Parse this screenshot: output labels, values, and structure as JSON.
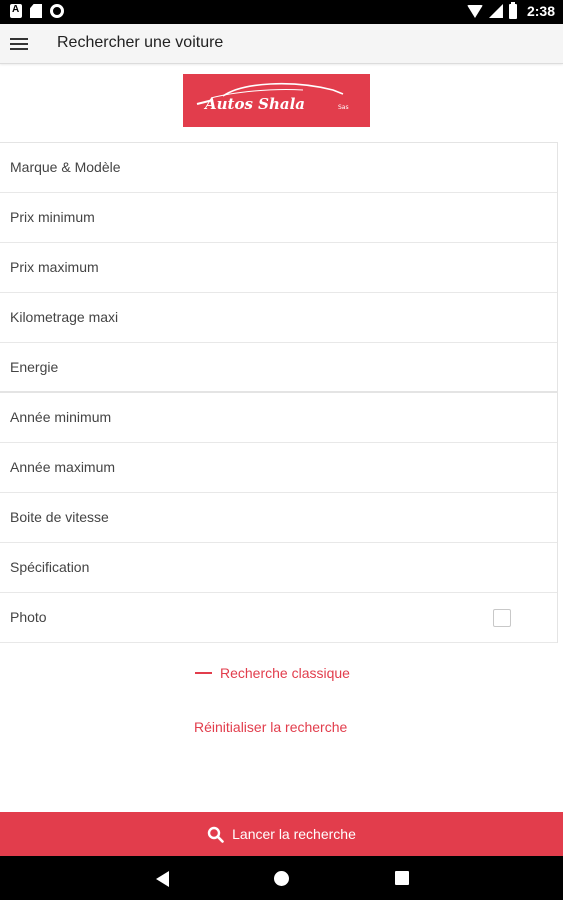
{
  "status_bar": {
    "time": "2:38",
    "icons": [
      "a-app-icon",
      "sd-card-icon",
      "circle-icon",
      "wifi-icon",
      "signal-icon",
      "battery-icon"
    ]
  },
  "toolbar": {
    "title": "Rechercher une voiture",
    "menu_icon": "hamburger-menu-icon"
  },
  "logo": {
    "text": "Autos Shala",
    "suffix": "Sas",
    "background_color": "#e23d4c"
  },
  "form": {
    "fields": [
      {
        "label": "Marque & Modèle"
      },
      {
        "label": "Prix minimum"
      },
      {
        "label": "Prix maximum"
      },
      {
        "label": "Kilometrage maxi"
      },
      {
        "label": "Energie"
      },
      {
        "label": "Année minimum"
      },
      {
        "label": "Année maximum"
      },
      {
        "label": "Boite de vitesse"
      },
      {
        "label": "Spécification"
      },
      {
        "label": "Photo",
        "checkbox": true,
        "checked": false
      }
    ]
  },
  "links": {
    "classic_search": "Recherche classique",
    "reset_search": "Réinitialiser la recherche"
  },
  "launch_button": {
    "label": "Lancer la recherche",
    "icon": "search-icon"
  },
  "nav_bar": {
    "icons": [
      "back-icon",
      "home-icon",
      "recent-apps-icon"
    ]
  },
  "colors": {
    "accent": "#e23d4c",
    "status_bar": "#000000",
    "toolbar": "#f5f5f5"
  }
}
